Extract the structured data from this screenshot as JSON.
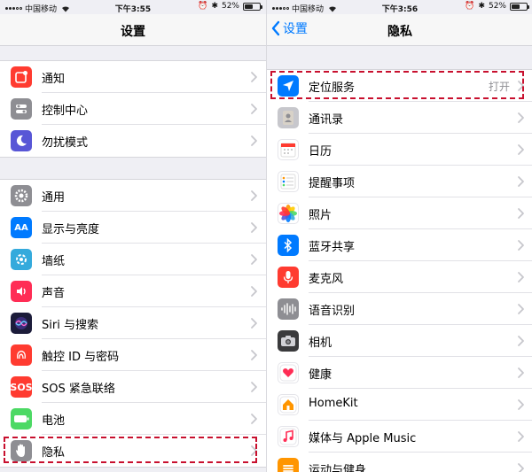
{
  "colors": {
    "accent": "#007aff",
    "highlight": "#c8102e"
  },
  "left": {
    "status": {
      "carrier": "中国移动",
      "time": "下午3:55",
      "battery": "52%",
      "battery_fraction": 0.52
    },
    "title": "设置",
    "group1": [
      {
        "label": "通知",
        "icon": "notification-icon",
        "color": "#ff3b30"
      },
      {
        "label": "控制中心",
        "icon": "control-center-icon",
        "color": "#8e8e93"
      },
      {
        "label": "勿扰模式",
        "icon": "moon-icon",
        "color": "#5856d6"
      }
    ],
    "group2": [
      {
        "label": "通用",
        "icon": "gear-icon",
        "color": "#8e8e93"
      },
      {
        "label": "显示与亮度",
        "icon": "display-icon",
        "color": "#007aff"
      },
      {
        "label": "墙纸",
        "icon": "wallpaper-icon",
        "color": "#34aadc"
      },
      {
        "label": "声音",
        "icon": "sound-icon",
        "color": "#ff2d55"
      },
      {
        "label": "Siri 与搜索",
        "icon": "siri-icon",
        "color": "#1c1c3a"
      },
      {
        "label": "触控 ID 与密码",
        "icon": "fingerprint-icon",
        "color": "#ff3b30"
      },
      {
        "label": "SOS 紧急联络",
        "icon": "sos-icon",
        "color": "#ff3b30",
        "glyph": "SOS"
      },
      {
        "label": "电池",
        "icon": "battery-icon",
        "color": "#4cd964"
      },
      {
        "label": "隐私",
        "icon": "hand-icon",
        "color": "#8e8e93"
      }
    ]
  },
  "right": {
    "status": {
      "carrier": "中国移动",
      "time": "下午3:56",
      "battery": "52%",
      "battery_fraction": 0.52
    },
    "back_label": "设置",
    "title": "隐私",
    "items": [
      {
        "label": "定位服务",
        "icon": "location-arrow-icon",
        "color": "#007aff",
        "value": "打开"
      },
      {
        "label": "通讯录",
        "icon": "contacts-icon",
        "color": "#c7c7cc"
      },
      {
        "label": "日历",
        "icon": "calendar-icon",
        "color": "#ffffff"
      },
      {
        "label": "提醒事项",
        "icon": "reminders-icon",
        "color": "#ffffff"
      },
      {
        "label": "照片",
        "icon": "photos-icon",
        "color": "#ffffff"
      },
      {
        "label": "蓝牙共享",
        "icon": "bluetooth-icon",
        "color": "#007aff"
      },
      {
        "label": "麦克风",
        "icon": "microphone-icon",
        "color": "#ff3b30"
      },
      {
        "label": "语音识别",
        "icon": "speech-recognition-icon",
        "color": "#8e8e93"
      },
      {
        "label": "相机",
        "icon": "camera-icon",
        "color": "#3a3a3c"
      },
      {
        "label": "健康",
        "icon": "health-icon",
        "color": "#ffffff"
      },
      {
        "label": "HomeKit",
        "icon": "home-icon",
        "color": "#ffffff"
      },
      {
        "label": "媒体与 Apple Music",
        "icon": "music-icon",
        "color": "#ffffff"
      },
      {
        "label": "运动与健身",
        "icon": "fitness-icon",
        "color": "#ff9500"
      }
    ]
  }
}
